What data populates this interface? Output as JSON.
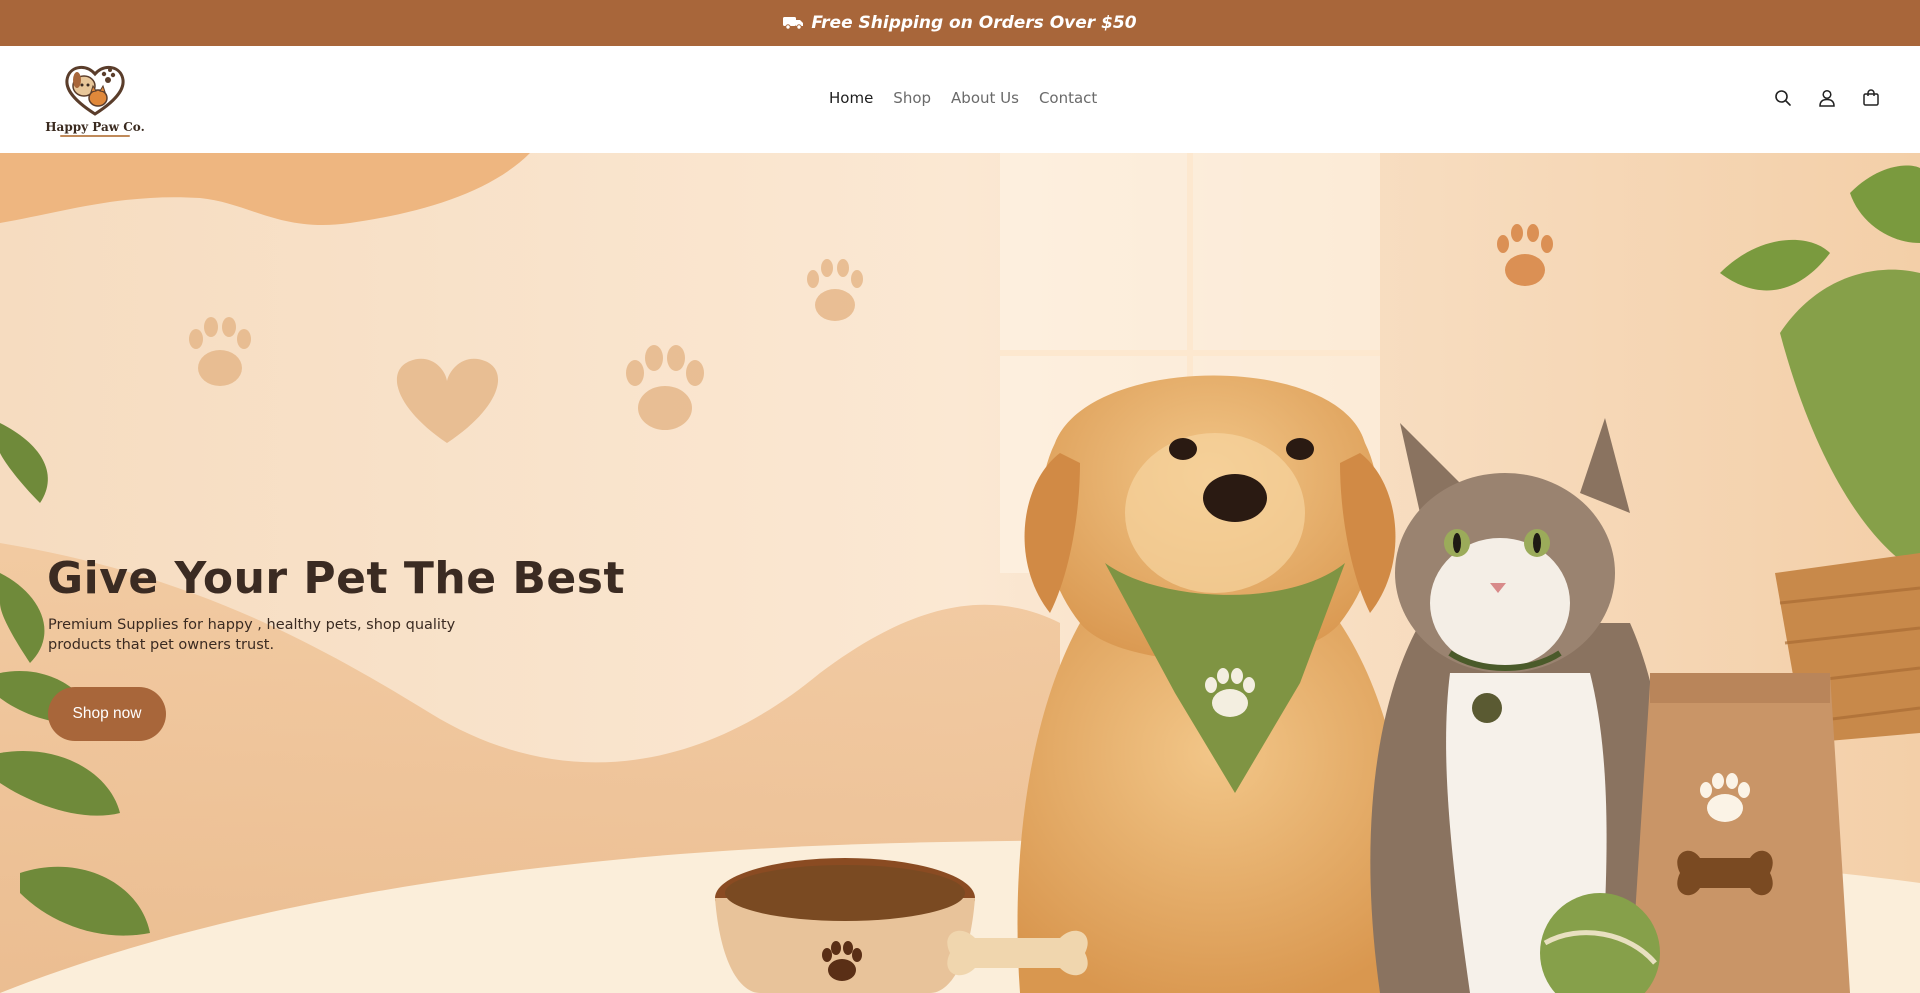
{
  "announcement": {
    "text": "Free Shipping on Orders Over $50",
    "icon": "truck-icon"
  },
  "brand": {
    "name": "Happy Paw Co.",
    "colors": {
      "primary": "#a8663a",
      "text_dark": "#3b2b22"
    }
  },
  "nav": {
    "items": [
      {
        "label": "Home",
        "active": true
      },
      {
        "label": "Shop",
        "active": false
      },
      {
        "label": "About Us",
        "active": false
      },
      {
        "label": "Contact",
        "active": false
      }
    ]
  },
  "header_icons": [
    "search-icon",
    "account-icon",
    "cart-icon"
  ],
  "hero": {
    "title": "Give Your Pet The Best",
    "subtitle": "Premium Supplies for happy , healthy pets, shop quality products that pet owners trust.",
    "cta_label": "Shop now"
  }
}
